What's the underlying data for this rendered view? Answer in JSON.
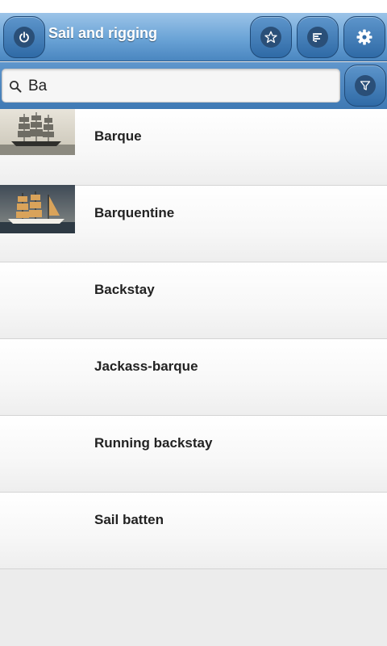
{
  "app": {
    "title": "Sail and rigging"
  },
  "header": {
    "power_icon": "power-icon",
    "favorites_icon": "star-icon",
    "list_icon": "sort-list-icon",
    "settings_icon": "gear-icon"
  },
  "search": {
    "value": "Ba",
    "placeholder": ""
  },
  "results": [
    {
      "label": "Barque",
      "thumbnail": "barque-photo"
    },
    {
      "label": "Barquentine",
      "thumbnail": "barquentine-photo"
    },
    {
      "label": "Backstay"
    },
    {
      "label": "Jackass-barque"
    },
    {
      "label": "Running backstay"
    },
    {
      "label": "Sail batten"
    }
  ],
  "colors": {
    "header_top": "#9cc4e8",
    "header_bottom": "#4a86c0",
    "button_dark": "#2a4f78",
    "list_background": "#ececec"
  }
}
